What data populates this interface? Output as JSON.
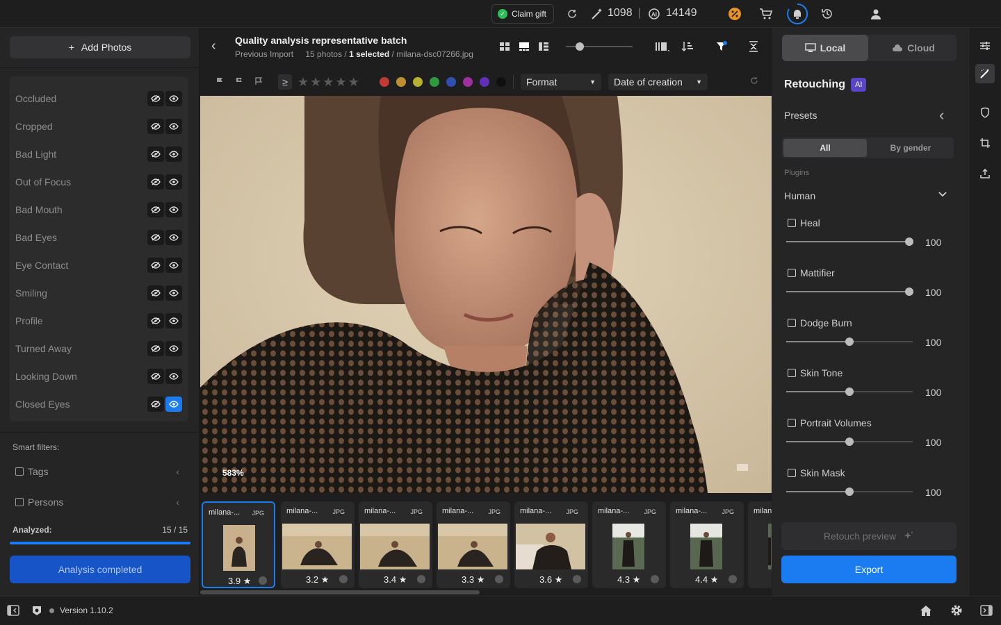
{
  "topbar": {
    "claim_gift": "Claim gift",
    "credits_a": "1098",
    "separator": "|",
    "credits_b": "14149"
  },
  "left": {
    "add_photos": "Add Photos",
    "filters": [
      {
        "label": "Occluded",
        "visible": false
      },
      {
        "label": "Cropped",
        "visible": false
      },
      {
        "label": "Bad Light",
        "visible": false
      },
      {
        "label": "Out of Focus",
        "visible": false
      },
      {
        "label": "Bad Mouth",
        "visible": false
      },
      {
        "label": "Bad Eyes",
        "visible": false
      },
      {
        "label": "Eye Contact",
        "visible": false
      },
      {
        "label": "Smiling",
        "visible": false
      },
      {
        "label": "Profile",
        "visible": false
      },
      {
        "label": "Turned Away",
        "visible": false
      },
      {
        "label": "Looking Down",
        "visible": false
      },
      {
        "label": "Closed Eyes",
        "visible": true
      }
    ],
    "smart_filters_label": "Smart filters:",
    "tags_label": "Tags",
    "persons_label": "Persons",
    "analyzed_label": "Analyzed:",
    "analyzed_count": "15 / 15",
    "analyzed_progress": 1.0,
    "analysis_button": "Analysis completed"
  },
  "center": {
    "title": "Quality analysis representative batch",
    "subtitle_prefix": "Previous Import",
    "photos_count": "15 photos /",
    "selected": "1 selected",
    "filename": "/ milana-dsc07266.jpg",
    "rating_op": "≥",
    "format_dropdown": "Format",
    "sort_dropdown": "Date of creation",
    "zoom": "583%",
    "color_labels": [
      "#c23a36",
      "#c09030",
      "#b8b030",
      "#2e9a40",
      "#3050b0",
      "#a030a0",
      "#6030b8",
      "#101010"
    ],
    "thumbnails": [
      {
        "name": "milana-...",
        "format": "JPG",
        "rating": "3.9",
        "selected": true
      },
      {
        "name": "milana-...",
        "format": "JPG",
        "rating": "3.2",
        "selected": false
      },
      {
        "name": "milana-...",
        "format": "JPG",
        "rating": "3.4",
        "selected": false
      },
      {
        "name": "milana-...",
        "format": "JPG",
        "rating": "3.3",
        "selected": false
      },
      {
        "name": "milana-...",
        "format": "JPG",
        "rating": "3.6",
        "selected": false
      },
      {
        "name": "milana-...",
        "format": "JPG",
        "rating": "4.3",
        "selected": false
      },
      {
        "name": "milana-...",
        "format": "JPG",
        "rating": "4.4",
        "selected": false
      },
      {
        "name": "milan",
        "format": "",
        "rating": "",
        "selected": false
      }
    ]
  },
  "right": {
    "local_tab": "Local",
    "cloud_tab": "Cloud",
    "retouching": "Retouching",
    "ai_badge": "AI",
    "presets": "Presets",
    "seg_all": "All",
    "seg_gender": "By gender",
    "plugins_label": "Plugins",
    "plugin_group": "Human",
    "sliders": [
      {
        "label": "Heal",
        "value": "100",
        "level": 0.97
      },
      {
        "label": "Mattifier",
        "value": "100",
        "level": 0.97
      },
      {
        "label": "Dodge Burn",
        "value": "100",
        "level": 0.5
      },
      {
        "label": "Skin Tone",
        "value": "100",
        "level": 0.5
      },
      {
        "label": "Portrait Volumes",
        "value": "100",
        "level": 0.5
      },
      {
        "label": "Skin Mask",
        "value": "100",
        "level": 0.5
      }
    ],
    "retouch_preview": "Retouch preview",
    "export": "Export"
  },
  "bottombar": {
    "version": "Version 1.10.2"
  }
}
